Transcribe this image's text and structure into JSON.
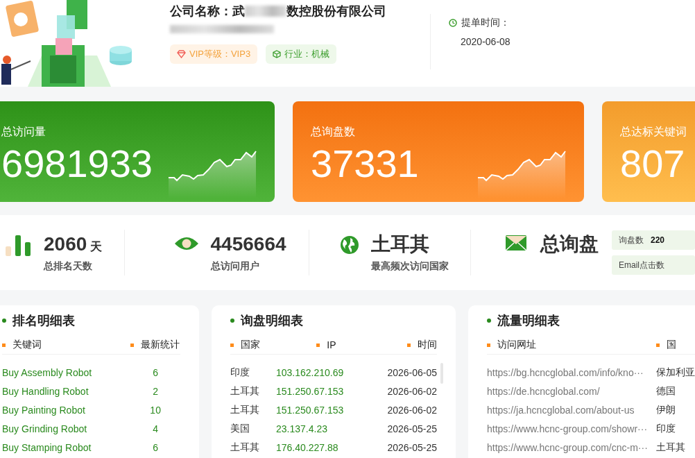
{
  "company": {
    "name_prefix": "公司名称：武",
    "name_suffix": "数控股份有限公司",
    "badges": [
      {
        "kind": "vip",
        "label": "VIP等级：VIP3"
      },
      {
        "kind": "industry",
        "label": "行业：机械"
      }
    ]
  },
  "order_time": {
    "label": "提单时间：",
    "value": "2020-06-08"
  },
  "summary_cards": [
    {
      "label": "总访问量",
      "value": "6981933",
      "color": "#3a9e24"
    },
    {
      "label": "总询盘数",
      "value": "37331",
      "color": "#ff7d1c"
    },
    {
      "label": "总达标关键词",
      "value": "807",
      "color": "#ffa838"
    }
  ],
  "stats": [
    {
      "kind": "bars",
      "value": "2060",
      "unit": "天",
      "label": "总排名天数"
    },
    {
      "kind": "eye",
      "value": "4456664",
      "label": "总访问用户"
    },
    {
      "kind": "globe",
      "value": "土耳其",
      "label": "最高频次访问国家"
    },
    {
      "kind": "mail",
      "value": "总询盘"
    }
  ],
  "side_metrics": [
    {
      "label": "询盘数",
      "value": "220"
    },
    {
      "label": "Email点击数"
    }
  ],
  "ranking_table": {
    "title": "排名明细表",
    "columns": [
      "关键词",
      "最新统计"
    ],
    "rows": [
      [
        "Buy Assembly Robot",
        "6"
      ],
      [
        "Buy Handling Robot",
        "2"
      ],
      [
        "Buy Painting Robot",
        "10"
      ],
      [
        "Buy Grinding Robot",
        "4"
      ],
      [
        "Buy Stamping Robot",
        "6"
      ]
    ]
  },
  "inquiry_table": {
    "title": "询盘明细表",
    "columns": [
      "国家",
      "IP",
      "时间"
    ],
    "rows": [
      [
        "印度",
        "103.162.210.69",
        "2026-06-05"
      ],
      [
        "土耳其",
        "151.250.67.153",
        "2026-06-02"
      ],
      [
        "土耳其",
        "151.250.67.153",
        "2026-06-02"
      ],
      [
        "美国",
        "23.137.4.23",
        "2026-05-25"
      ],
      [
        "土耳其",
        "176.40.227.88",
        "2026-05-25"
      ]
    ]
  },
  "traffic_table": {
    "title": "流量明细表",
    "columns": [
      "访问网址",
      "国"
    ],
    "rows": [
      [
        "https://bg.hcncglobal.com/info/kno···",
        "保加利亚"
      ],
      [
        "https://de.hcncglobal.com/",
        "德国"
      ],
      [
        "https://ja.hcncglobal.com/about-us",
        "伊朗"
      ],
      [
        "https://www.hcnc-group.com/showr···",
        "印度"
      ],
      [
        "https://www.hcnc-group.com/cnc-m···",
        "土耳其"
      ]
    ]
  }
}
